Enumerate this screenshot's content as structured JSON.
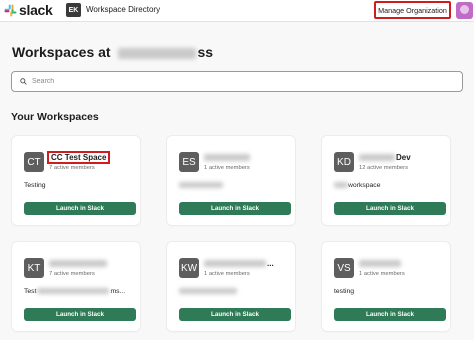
{
  "topbar": {
    "logo_text": "slack",
    "directory_badge": "EK",
    "directory_label": "Workspace Directory",
    "manage_label": "Manage Organization"
  },
  "page": {
    "title_prefix": "Workspaces at",
    "title_suffix": "ss"
  },
  "search": {
    "placeholder": "Search"
  },
  "section_title": "Your Workspaces",
  "colors": {
    "launch_button": "#2f7a57",
    "highlight_box": "#d01c1c",
    "icon_bg": "#5e5e5e"
  },
  "workspaces": [
    {
      "initials": "CT",
      "name": "CC Test Space",
      "members": "7 active members",
      "description": "Testing",
      "launch_label": "Launch in Slack"
    },
    {
      "initials": "ES",
      "name": "",
      "members": "1 active members",
      "description": "",
      "launch_label": "Launch in Slack"
    },
    {
      "initials": "KD",
      "name": "Dev",
      "members": "12 active members",
      "description": "workspace",
      "launch_label": "Launch in Slack"
    },
    {
      "initials": "KT",
      "name": "",
      "members": "7 active members",
      "description": "Test",
      "description_suffix": "ms...",
      "launch_label": "Launch in Slack"
    },
    {
      "initials": "KW",
      "name": "...",
      "members": "1 active members",
      "description": "",
      "launch_label": "Launch in Slack"
    },
    {
      "initials": "VS",
      "name": "",
      "members": "1 active members",
      "description": "testing",
      "launch_label": "Launch in Slack"
    }
  ]
}
